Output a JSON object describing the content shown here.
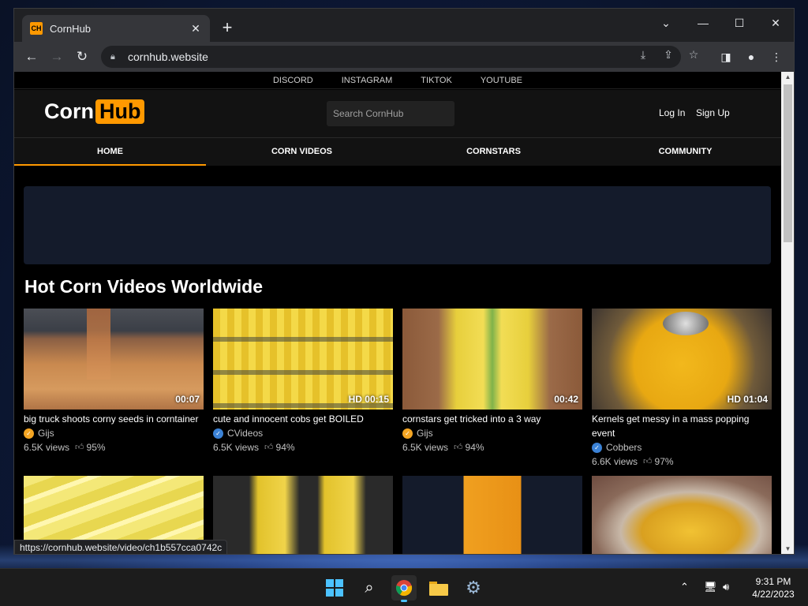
{
  "browser": {
    "tab_title": "CornHub",
    "tab_favicon": "CH",
    "url": "cornhub.website",
    "status_url": "https://cornhub.website/video/ch1b557cca0742c"
  },
  "site": {
    "social_links": [
      "DISCORD",
      "INSTAGRAM",
      "TIKTOK",
      "YOUTUBE"
    ],
    "logo_left": "Corn",
    "logo_right": "Hub",
    "search_placeholder": "Search CornHub",
    "login": "Log In",
    "signup": "Sign Up",
    "nav": [
      "HOME",
      "CORN VIDEOS",
      "CORNSTARS",
      "COMMUNITY"
    ],
    "section_title": "Hot Corn Videos Worldwide"
  },
  "videos": [
    {
      "title": "big truck shoots corny seeds in corntainer",
      "duration": "00:07",
      "uploader": "Gijs",
      "verified_color": "#f5a623",
      "views": "6.5K views",
      "rating": "95%"
    },
    {
      "title": "cute and innocent cobs get BOILED",
      "duration": "HD 00:15",
      "uploader": "CVideos",
      "verified_color": "#3b82d6",
      "views": "6.5K views",
      "rating": "94%"
    },
    {
      "title": "cornstars get tricked into a 3 way",
      "duration": "00:42",
      "uploader": "Gijs",
      "verified_color": "#f5a623",
      "views": "6.5K views",
      "rating": "94%"
    },
    {
      "title": "Kernels get messy in a mass popping event",
      "duration": "HD 01:04",
      "uploader": "Cobbers",
      "verified_color": "#3b82d6",
      "views": "6.6K views",
      "rating": "97%"
    }
  ],
  "taskbar": {
    "time": "9:31 PM",
    "date": "4/22/2023"
  },
  "colors": {
    "accent": "#ff9900",
    "page_bg": "#000000",
    "header_bg": "#121212"
  }
}
